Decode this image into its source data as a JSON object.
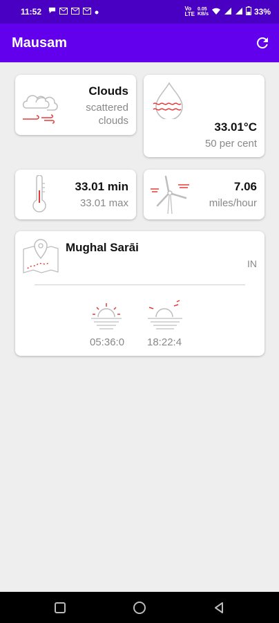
{
  "status_bar": {
    "time": "11:52",
    "data_rate": "0.05\nKB/s",
    "battery": "33%",
    "icons": [
      "chat-bubble-icon",
      "mail-icon",
      "mail-icon",
      "mail-icon",
      "dot-icon",
      "volte-icon",
      "wifi-icon",
      "signal-icon",
      "signal-icon",
      "battery-icon"
    ]
  },
  "app_bar": {
    "title": "Mausam",
    "refresh_icon": "refresh-icon"
  },
  "clouds_card": {
    "title": "Clouds",
    "desc_line1": "scattered",
    "desc_line2": "clouds",
    "icon": "cloud-wind-icon"
  },
  "humidity_card": {
    "temperature": "33.01°C",
    "humidity": "50 per cent",
    "icon": "water-drop-icon"
  },
  "temperature_card": {
    "min": "33.01 min",
    "max": "33.01 max",
    "icon": "thermometer-icon"
  },
  "wind_card": {
    "speed": "7.06",
    "unit": "miles/hour",
    "icon": "wind-turbine-icon"
  },
  "location_card": {
    "city": "Mughal Sarāi",
    "country": "IN",
    "sunrise": "05:36:0",
    "sunset": "18:22:4",
    "map_icon": "map-pin-icon",
    "sunrise_icon": "sunrise-icon",
    "sunset_icon": "sunset-icon"
  },
  "colors": {
    "status_bar": "#4a00c2",
    "app_bar": "#6200ee",
    "accent_red": "#e53935",
    "icon_gray": "#bdbdbd"
  },
  "nav_bar": {
    "icons": [
      "recents-square-icon",
      "home-circle-icon",
      "back-triangle-icon"
    ]
  }
}
